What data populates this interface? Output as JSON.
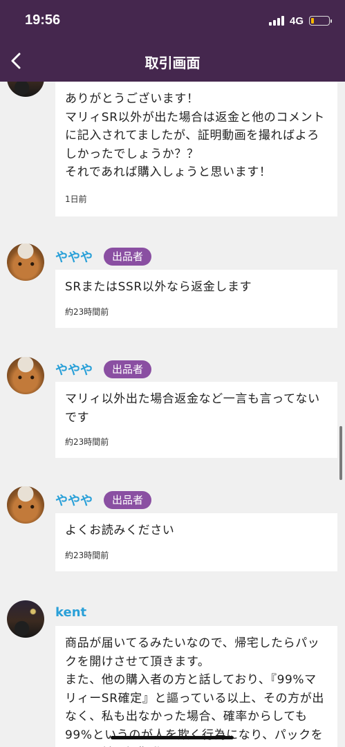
{
  "status": {
    "time": "19:56",
    "network": "4G",
    "battery_level": 0.15
  },
  "nav": {
    "title": "取引画面"
  },
  "messages": [
    {
      "user": "",
      "badge": "",
      "text": "ありがとうございます！\nマリィSR以外が出た場合は返金と他のコメントに記入されてましたが、証明動画を撮ればよろしかったでしょうか？？\nそれであれば購入しょうと思います！",
      "time": "1日前"
    },
    {
      "user": "ややや",
      "badge": "出品者",
      "text": "SRまたはSSR以外なら返金します",
      "time": "約23時間前"
    },
    {
      "user": "ややや",
      "badge": "出品者",
      "text": "マリィ以外出た場合返金など一言も言ってないです",
      "time": "約23時間前"
    },
    {
      "user": "ややや",
      "badge": "出品者",
      "text": "よくお読みください",
      "time": "約23時間前"
    },
    {
      "user": "kent",
      "badge": "",
      "text": "商品が届いてるみたいなので、帰宅したらパックを開けさせて頂きます。\nまた、他の購入者の方と話しており、『99%マリィーSR確定』と謳っている以上、その方が出なく、私も出なかった場合、確率からしても99%というのが人を欺く行為になり、パックを開ける前に証拠動画を",
      "time": ""
    }
  ]
}
